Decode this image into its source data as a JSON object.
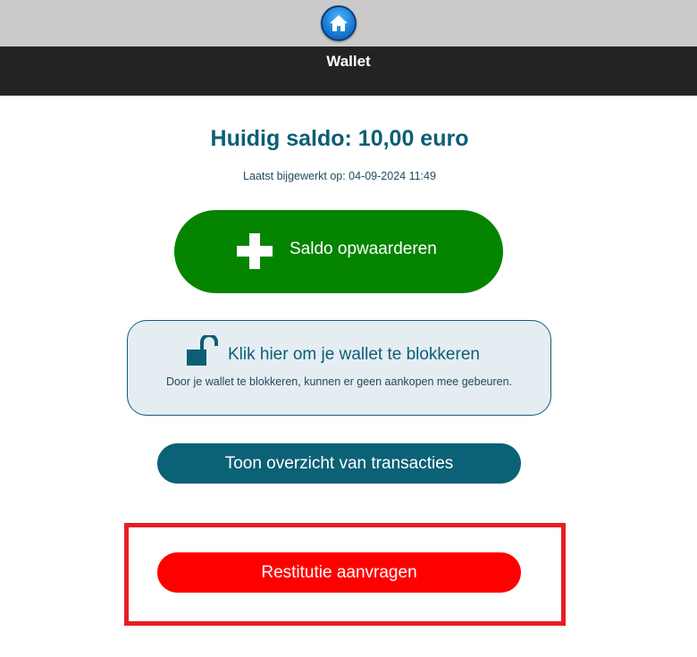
{
  "header": {
    "home_icon": "home-icon",
    "title": "Wallet"
  },
  "wallet": {
    "balance_text": "Huidig saldo: 10,00 euro",
    "updated_text": "Laatst bijgewerkt op: 04-09-2024 11:49"
  },
  "actions": {
    "topup_label": "Saldo opwaarderen",
    "topup_icon": "plus-icon",
    "block_label": "Klik hier om je wallet te blokkeren",
    "block_icon": "unlocked-padlock-icon",
    "block_description": "Door je wallet te blokkeren, kunnen er geen aankopen mee gebeuren.",
    "transactions_label": "Toon overzicht van transacties",
    "refund_label": "Restitutie aanvragen"
  },
  "colors": {
    "accent": "#0b5f75",
    "topup": "#058400",
    "refund": "#ff0000",
    "highlight": "#e41e25",
    "header_dark": "#232323"
  }
}
